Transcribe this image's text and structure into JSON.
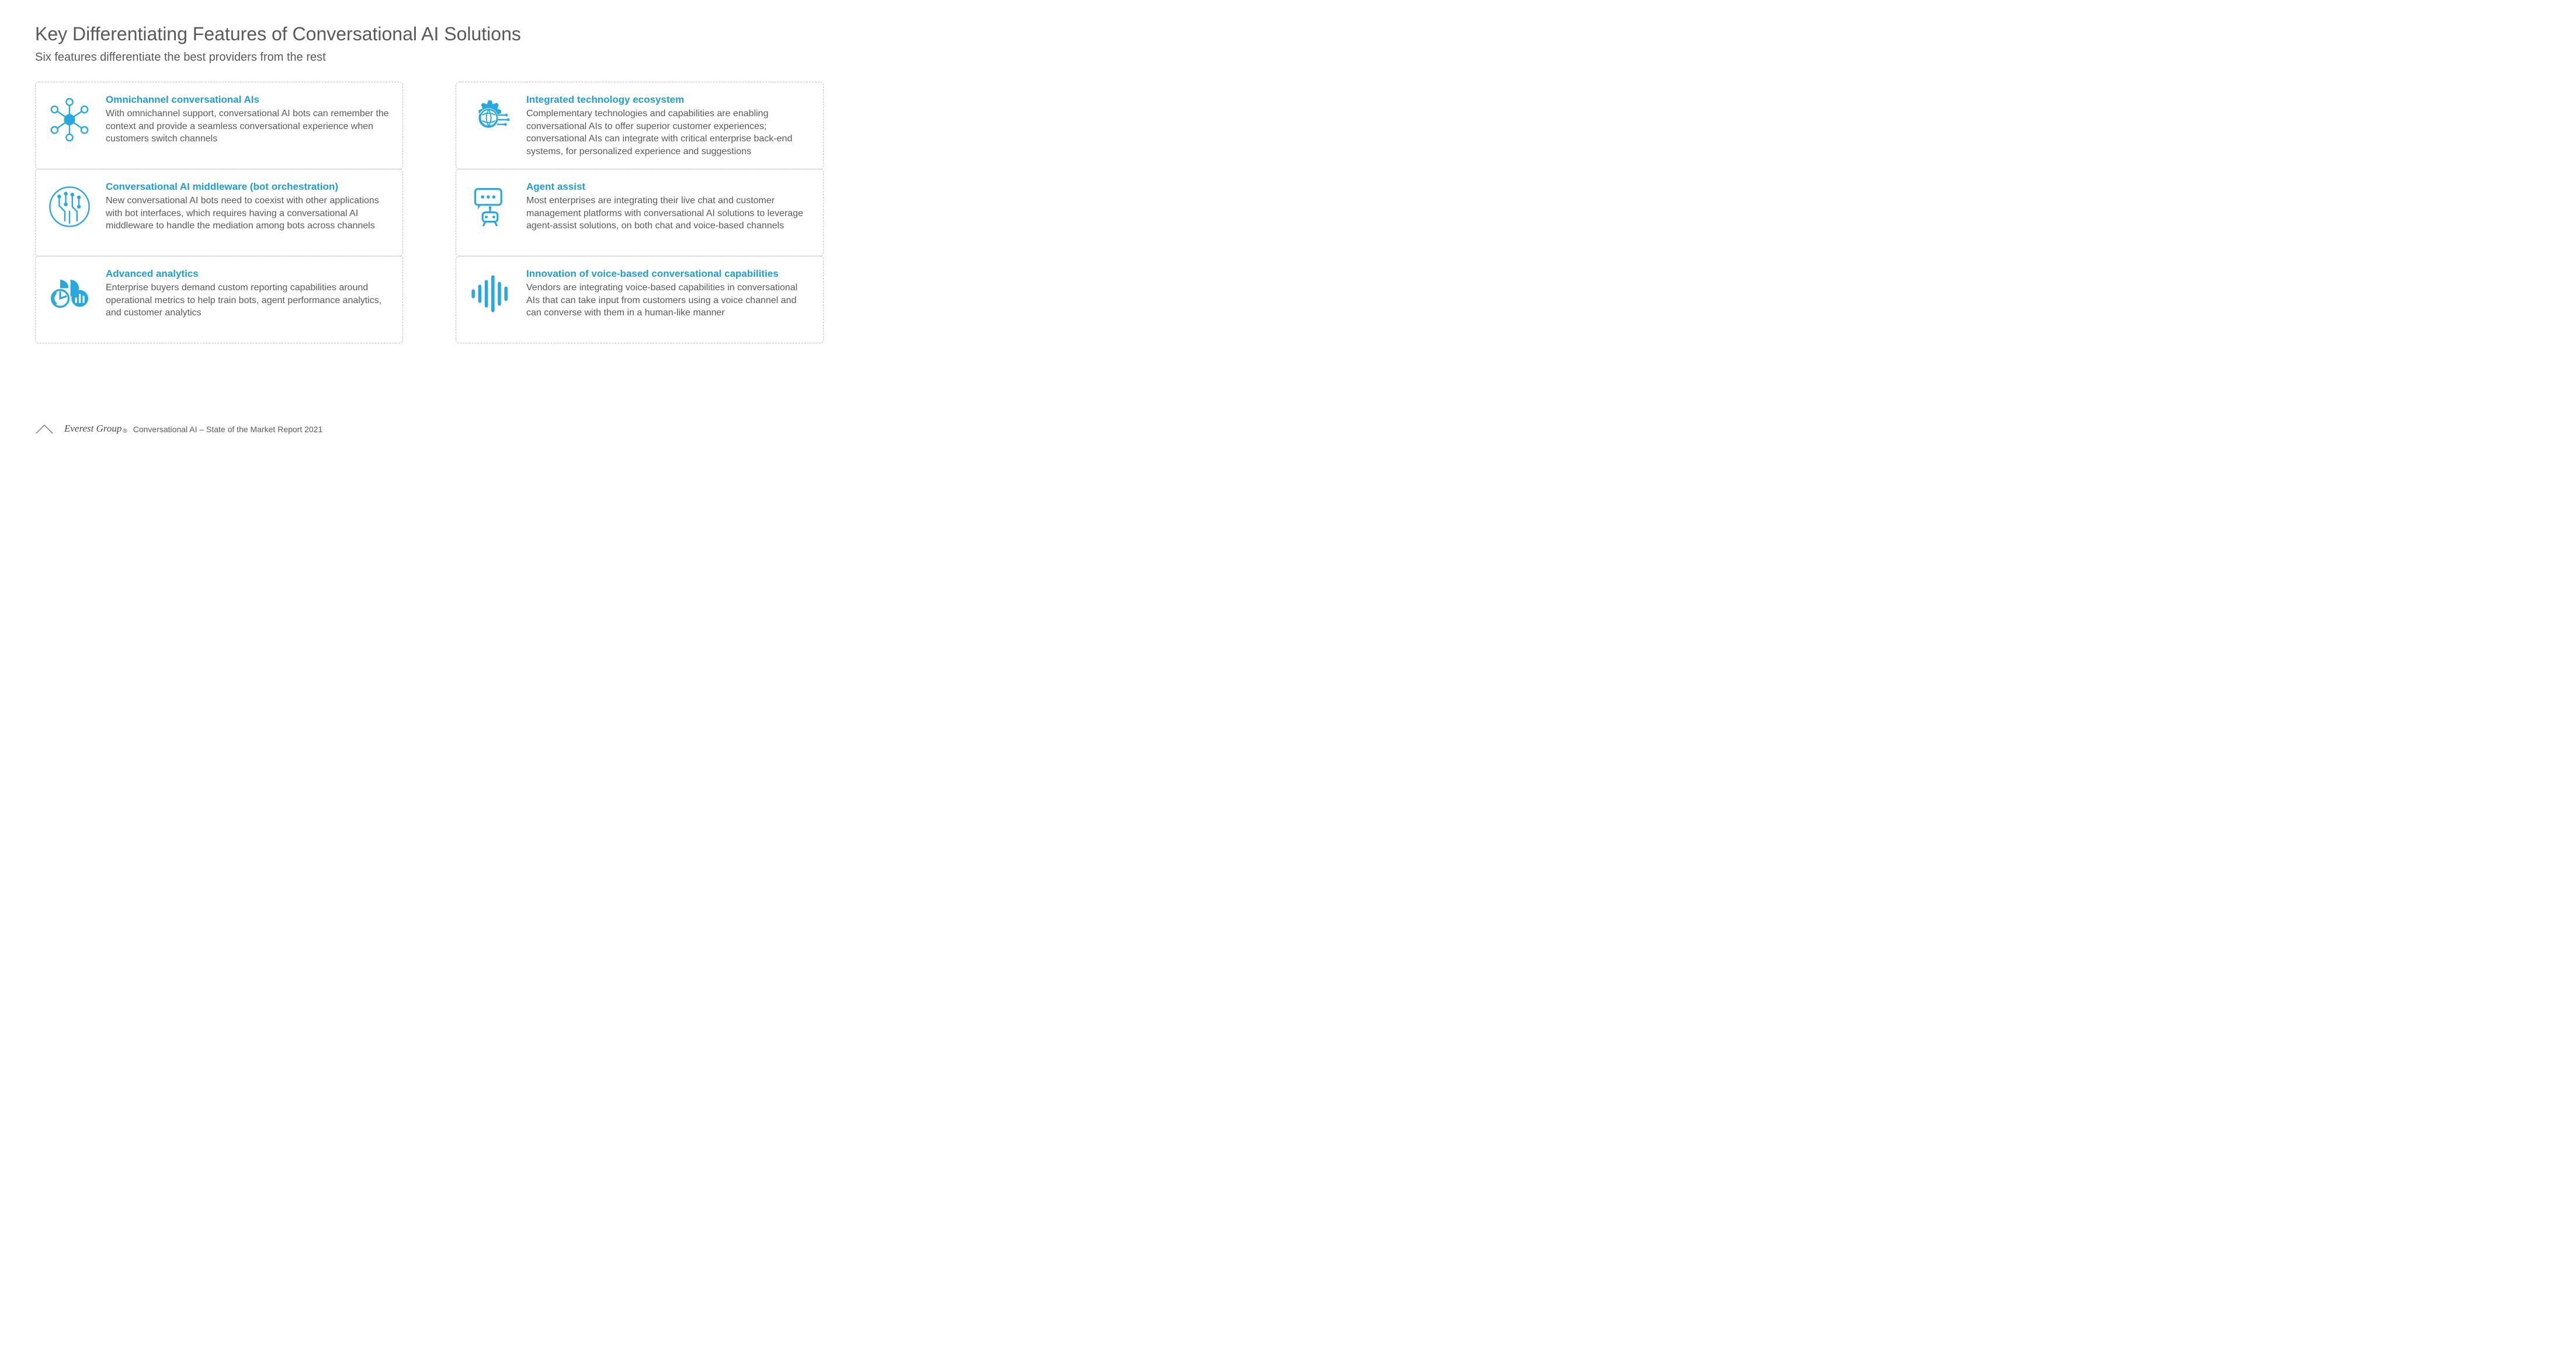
{
  "title": "Key Differentiating Features of Conversational AI Solutions",
  "subtitle": "Six features differentiate the best providers from the rest",
  "footer": {
    "brand": "Everest Group",
    "reg": "®",
    "report": "Conversational AI – State of the Market Report 2021"
  },
  "left": [
    {
      "title": "Omnichannel conversational AIs",
      "desc": "With omnichannel support, conversational AI bots can remember the context and provide a seamless conversational experience when customers switch channels"
    },
    {
      "title": "Conversational AI middleware (bot orchestration)",
      "desc": "New conversational AI bots need to coexist with other applications with bot interfaces, which requires having a conversational AI middleware to handle the mediation among bots across channels"
    },
    {
      "title": "Advanced analytics",
      "desc": "Enterprise buyers demand custom reporting capabilities around operational metrics to help train bots, agent performance analytics, and customer analytics"
    }
  ],
  "right": [
    {
      "title": "Integrated technology ecosystem",
      "desc": "Complementary technologies and capabilities are enabling conversational AIs to offer superior customer experiences; conversational AIs can integrate with critical enterprise back-end systems, for personalized experience and suggestions"
    },
    {
      "title": "Agent assist",
      "desc": "Most enterprises are integrating their live chat and customer management platforms with conversational AI solutions to leverage agent-assist solutions, on both chat and voice-based channels"
    },
    {
      "title": "Innovation of voice-based conversational capabilities",
      "desc": "Vendors are integrating voice-based capabilities in conversational AIs that can take input from customers using a voice channel and can converse with them in a human-like manner"
    }
  ]
}
